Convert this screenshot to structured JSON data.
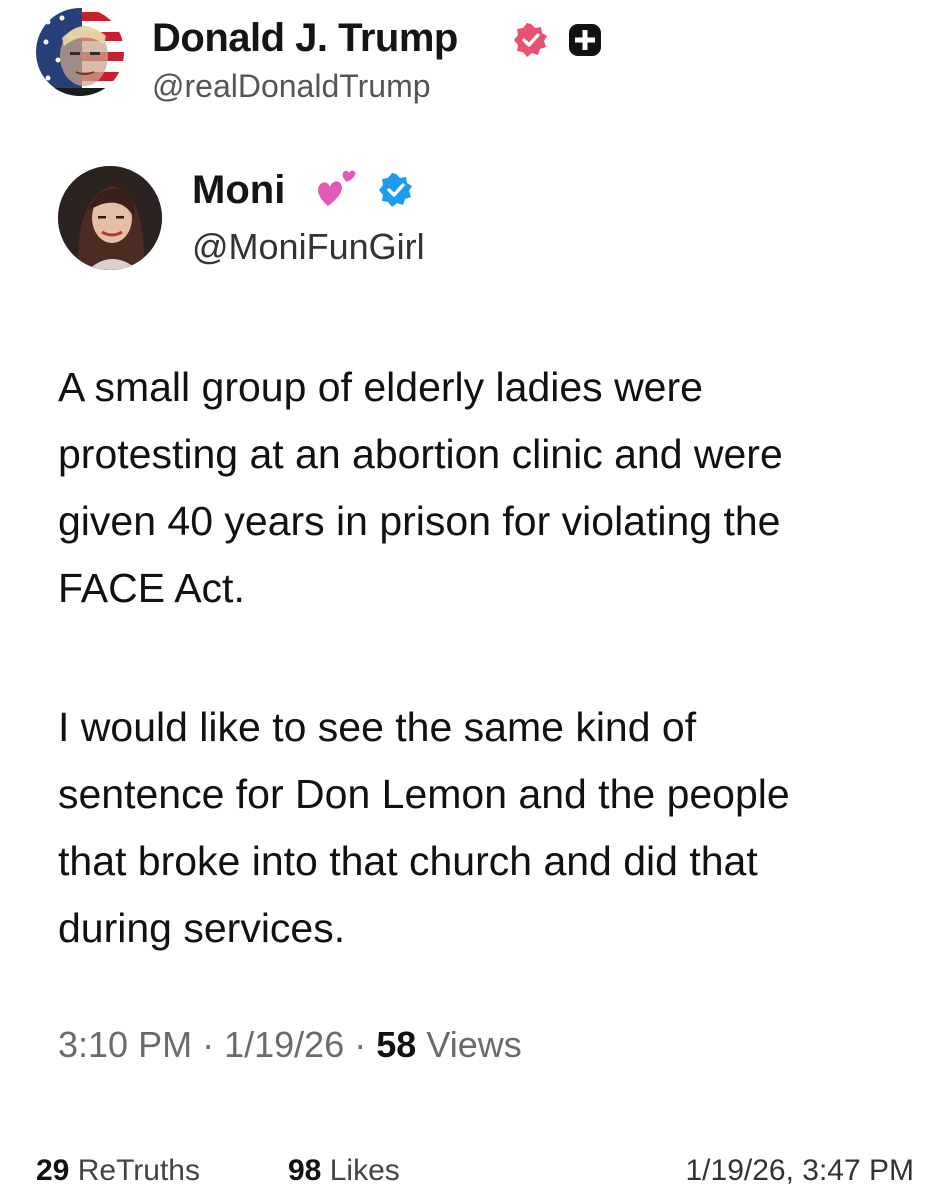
{
  "truth_post": {
    "author_name": "Donald J. Trump",
    "author_handle": "@realDonaldTrump",
    "accent_color": "#e8516f",
    "icons": {
      "badge": "verified-badge-icon",
      "plus": "plus-square-icon"
    }
  },
  "quoted_post": {
    "author_name": "Moni",
    "author_emoji": "💕",
    "author_handle": "@MoniFunGirl",
    "verified_color": "#1d9bf0",
    "paragraphs": [
      "A small group of elderly ladies were protesting at an abortion clinic and were given 40 years in prison for violating the FACE Act.",
      "I would like to see the same kind of sentence for Don Lemon and the people that broke into that church and did that during services."
    ],
    "meta": {
      "time": "3:10 PM",
      "date": "1/19/26",
      "separator": "·",
      "views_count": "58",
      "views_label": "Views"
    }
  },
  "footer": {
    "retruths_count": "29",
    "retruths_label": "ReTruths",
    "likes_count": "98",
    "likes_label": "Likes",
    "timestamp": "1/19/26, 3:47 PM"
  }
}
